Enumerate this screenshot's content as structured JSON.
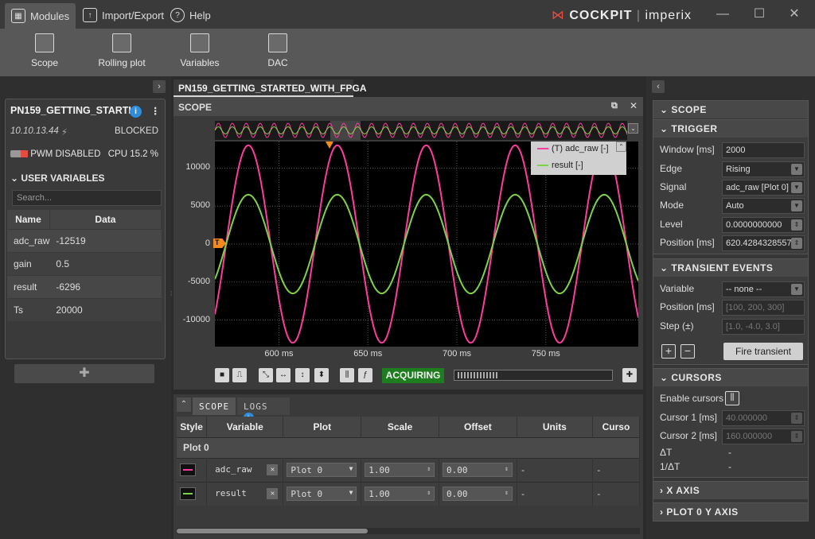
{
  "menu": {
    "modules": "Modules",
    "import_export": "Import/Export",
    "help": "Help"
  },
  "brand": {
    "cockpit": "COCKPIT",
    "imperix": "imperix"
  },
  "ribbon": [
    {
      "label": "Scope"
    },
    {
      "label": "Rolling plot"
    },
    {
      "label": "Variables"
    },
    {
      "label": "DAC"
    }
  ],
  "device": {
    "name": "PN159_GETTING_STARTI",
    "ip": "10.10.13.44",
    "state": "BLOCKED",
    "pwm": "PWM DISABLED",
    "cpu": "CPU 15.2 %",
    "section": "USER VARIABLES",
    "search_placeholder": "Search...",
    "col_name": "Name",
    "col_data": "Data",
    "variables": [
      {
        "name": "adc_raw",
        "data": "-12519"
      },
      {
        "name": "gain",
        "data": "0.5"
      },
      {
        "name": "result",
        "data": "-6296"
      },
      {
        "name": "Ts",
        "data": "20000"
      }
    ]
  },
  "center": {
    "tab": "PN159_GETTING_STARTED_WITH_FPGA",
    "scope_title": "SCOPE",
    "status": "ACQUIRING",
    "legend": [
      {
        "label": "(T) adc_raw  [-]",
        "color": "#ff3c9e"
      },
      {
        "label": "result  [-]",
        "color": "#7ed348"
      }
    ],
    "trigger_marker": "T"
  },
  "chart_data": {
    "type": "line",
    "xlim": [
      564,
      802
    ],
    "ylim": [
      -13500,
      13500
    ],
    "x_ticks": [
      {
        "v": 600,
        "label": "600 ms"
      },
      {
        "v": 650,
        "label": "650 ms"
      },
      {
        "v": 700,
        "label": "700 ms"
      },
      {
        "v": 750,
        "label": "750 ms"
      }
    ],
    "y_ticks": [
      {
        "v": 10000,
        "label": "10000"
      },
      {
        "v": 5000,
        "label": "5000"
      },
      {
        "v": 0,
        "label": "0"
      },
      {
        "v": -5000,
        "label": "-5000"
      },
      {
        "v": -10000,
        "label": "-10000"
      }
    ],
    "grid": true,
    "legend_position": "top-right",
    "series": [
      {
        "name": "(T) adc_raw  [-]",
        "color": "#ff3c9e",
        "amplitude": 13000,
        "period_ms": 50,
        "zero_cross_ms": 570.3
      },
      {
        "name": "result  [-]",
        "color": "#7ed348",
        "amplitude": 6500,
        "period_ms": 50,
        "zero_cross_ms": 570.3
      }
    ]
  },
  "bottom": {
    "tabs": [
      {
        "label": "SCOPE"
      },
      {
        "label": "LOGS"
      }
    ],
    "columns": [
      "Style",
      "Variable",
      "Plot",
      "Scale",
      "Offset",
      "Units",
      "Curso"
    ],
    "group": "Plot 0",
    "rows": [
      {
        "color": "#ff3c9e",
        "variable": "adc_raw",
        "plot": "Plot 0",
        "scale": "1.00",
        "offset": "0.00",
        "units": "-",
        "cursor": "-"
      },
      {
        "color": "#7ed348",
        "variable": "result",
        "plot": "Plot 0",
        "scale": "1.00",
        "offset": "0.00",
        "units": "-",
        "cursor": "-"
      }
    ]
  },
  "right": {
    "scope": "SCOPE",
    "trigger": {
      "title": "TRIGGER",
      "window_label": "Window [ms]",
      "window": "2000",
      "edge_label": "Edge",
      "edge": "Rising",
      "signal_label": "Signal",
      "signal": "adc_raw [Plot 0]",
      "mode_label": "Mode",
      "mode": "Auto",
      "level_label": "Level",
      "level": "0.0000000000",
      "position_label": "Position [ms]",
      "position": "620.4284328557"
    },
    "transient": {
      "title": "TRANSIENT EVENTS",
      "variable_label": "Variable",
      "variable": "-- none --",
      "position_label": "Position [ms]",
      "position": "[100, 200, 300]",
      "step_label": "Step (±)",
      "step": "[1.0, -4.0, 3.0]",
      "fire": "Fire transient"
    },
    "cursors": {
      "title": "CURSORS",
      "enable_label": "Enable cursors",
      "c1_label": "Cursor 1 [ms]",
      "c1": "40.000000",
      "c2_label": "Cursor 2 [ms]",
      "c2": "160.000000",
      "dt_label": "ΔT",
      "dt": "-",
      "inv_label": "1/ΔT",
      "inv": "-"
    },
    "x_axis": "X AXIS",
    "y_axis": "PLOT 0 Y AXIS"
  }
}
